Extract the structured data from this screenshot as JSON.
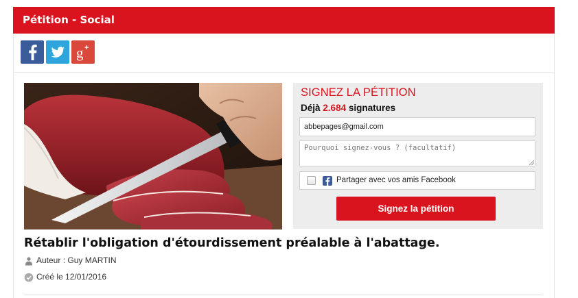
{
  "header": {
    "title": "Pétition - Social"
  },
  "social": {
    "buttons": [
      {
        "icon": "facebook-icon",
        "glyph": "f",
        "color": "#3b5c9b"
      },
      {
        "icon": "twitter-icon",
        "color": "#2ea5dd"
      },
      {
        "icon": "google-plus-icon",
        "glyph": "g+",
        "color": "#d9483b"
      }
    ]
  },
  "sign_box": {
    "title": "SIGNEZ LA PÉTITION",
    "count_prefix": "Déjà",
    "count": "2.684",
    "count_suffix": "signatures",
    "email_value": "abbepages@gmail.com",
    "reason_placeholder": "Pourquoi signez-vous ? (facultatif)",
    "share_label": "Partager avec vos amis Facebook",
    "share_checked": false,
    "submit_label": "Signez la pétition"
  },
  "petition": {
    "title": "Rétablir l'obligation d'étourdissement préalable à l'abattage.",
    "author": "Auteur : Guy MARTIN",
    "created": "Créé le 12/01/2016"
  },
  "colors": {
    "accent": "#d9141e",
    "facebook": "#3b5c9b",
    "twitter": "#2ea5dd",
    "google_plus": "#d9483b"
  }
}
